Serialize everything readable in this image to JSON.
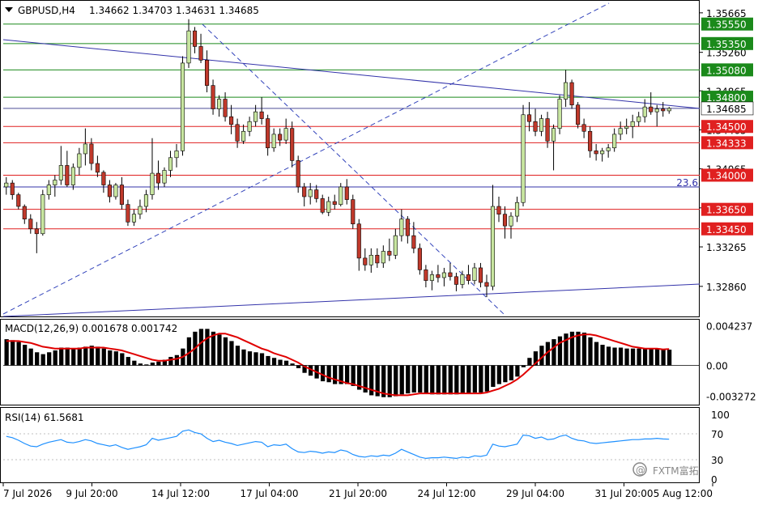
{
  "header": {
    "symbol": "GBPUSD,H4",
    "ohlc": "1.34662 1.34703 1.34631 1.34685"
  },
  "indicators": {
    "macd_label": "MACD(12,26,9) 0.001678 0.001742",
    "rsi_label": "RSI(14) 61.5681",
    "fib_label": "23.6"
  },
  "watermark": {
    "text": "FXTM富拓",
    "logo_text": "@"
  },
  "chart_data": [
    {
      "type": "candlestick",
      "name": "price",
      "title": "",
      "colors": {
        "bull": "#c8e6a0",
        "bear": "#c0392b",
        "wick": "#000000",
        "grid": "#d0d0d0",
        "frame": "#000000"
      },
      "ylim": [
        1.3256,
        1.3578
      ],
      "yticks": [
        1.35665,
        1.3526,
        1.34865,
        1.34465,
        1.34065,
        1.33665,
        1.33265,
        1.3286
      ],
      "ytick_labels": [
        "1.35665",
        "1.35260",
        "1.34865",
        "1.34465",
        "1.34065",
        "1.33665",
        "1.33265",
        "1.32860"
      ],
      "hlines": [
        {
          "value": 1.3555,
          "label": "1.35550",
          "color": "#1b8a1b"
        },
        {
          "value": 1.3535,
          "label": "1.35350",
          "color": "#1b8a1b"
        },
        {
          "value": 1.3508,
          "label": "1.35080",
          "color": "#1b8a1b"
        },
        {
          "value": 1.348,
          "label": "1.34800",
          "color": "#1b8a1b"
        },
        {
          "value": 1.345,
          "label": "1.34500",
          "color": "#e02020"
        },
        {
          "value": 1.34333,
          "label": "1.34333",
          "color": "#e02020"
        },
        {
          "value": 1.34,
          "label": "1.34000",
          "color": "#e02020"
        },
        {
          "value": 1.3365,
          "label": "1.33650",
          "color": "#e02020"
        },
        {
          "value": 1.3345,
          "label": "1.33450",
          "color": "#e02020"
        }
      ],
      "current_price": {
        "value": 1.34685,
        "label": "1.34685"
      },
      "fib_line": {
        "value": 1.3388,
        "label": "23.6"
      },
      "x_labels": [
        "7 Jul 2026",
        "9 Jul 20:00",
        "14 Jul 12:00",
        "17 Jul 04:00",
        "21 Jul 20:00",
        "24 Jul 12:00",
        "29 Jul 04:00",
        "31 Jul 20:00",
        "5 Aug 12:00"
      ],
      "candles": [
        [
          1.3388,
          1.3398,
          1.338,
          1.3392
        ],
        [
          1.3392,
          1.3395,
          1.3375,
          1.338
        ],
        [
          1.338,
          1.3382,
          1.3365,
          1.3368
        ],
        [
          1.3368,
          1.337,
          1.335,
          1.3355
        ],
        [
          1.3355,
          1.336,
          1.334,
          1.3345
        ],
        [
          1.3345,
          1.3352,
          1.332,
          1.334
        ],
        [
          1.334,
          1.3385,
          1.3338,
          1.338
        ],
        [
          1.338,
          1.3395,
          1.3375,
          1.339
        ],
        [
          1.339,
          1.34,
          1.3378,
          1.3395
        ],
        [
          1.3395,
          1.343,
          1.339,
          1.341
        ],
        [
          1.341,
          1.3425,
          1.3388,
          1.339
        ],
        [
          1.339,
          1.3412,
          1.3385,
          1.3408
        ],
        [
          1.3408,
          1.3428,
          1.34,
          1.3422
        ],
        [
          1.3422,
          1.3448,
          1.341,
          1.3432
        ],
        [
          1.3432,
          1.3438,
          1.3405,
          1.3412
        ],
        [
          1.3412,
          1.342,
          1.3398,
          1.3403
        ],
        [
          1.3403,
          1.3405,
          1.3382,
          1.339
        ],
        [
          1.339,
          1.3395,
          1.3372,
          1.3378
        ],
        [
          1.3378,
          1.3392,
          1.3375,
          1.339
        ],
        [
          1.339,
          1.3398,
          1.3365,
          1.337
        ],
        [
          1.337,
          1.3375,
          1.3348,
          1.3352
        ],
        [
          1.3352,
          1.3365,
          1.3348,
          1.336
        ],
        [
          1.336,
          1.3375,
          1.3355,
          1.3368
        ],
        [
          1.3368,
          1.3385,
          1.3362,
          1.338
        ],
        [
          1.338,
          1.3438,
          1.3375,
          1.3402
        ],
        [
          1.3402,
          1.3415,
          1.3385,
          1.3392
        ],
        [
          1.3392,
          1.3408,
          1.3388,
          1.3405
        ],
        [
          1.3405,
          1.3425,
          1.3398,
          1.3418
        ],
        [
          1.3418,
          1.3432,
          1.3408,
          1.3425
        ],
        [
          1.3425,
          1.3522,
          1.342,
          1.3515
        ],
        [
          1.3515,
          1.356,
          1.351,
          1.3548
        ],
        [
          1.3548,
          1.3552,
          1.3525,
          1.3532
        ],
        [
          1.3532,
          1.3545,
          1.3515,
          1.3518
        ],
        [
          1.3518,
          1.3528,
          1.3485,
          1.3492
        ],
        [
          1.3492,
          1.3498,
          1.3462,
          1.3468
        ],
        [
          1.3468,
          1.3482,
          1.346,
          1.3478
        ],
        [
          1.3478,
          1.3485,
          1.3455,
          1.346
        ],
        [
          1.346,
          1.3472,
          1.3442,
          1.3452
        ],
        [
          1.3452,
          1.3458,
          1.3428,
          1.3435
        ],
        [
          1.3435,
          1.3452,
          1.3432,
          1.3445
        ],
        [
          1.3445,
          1.346,
          1.344,
          1.3455
        ],
        [
          1.3455,
          1.3472,
          1.345,
          1.3465
        ],
        [
          1.3465,
          1.348,
          1.3452,
          1.3458
        ],
        [
          1.3458,
          1.3462,
          1.342,
          1.3428
        ],
        [
          1.3428,
          1.3448,
          1.3424,
          1.3442
        ],
        [
          1.3442,
          1.3448,
          1.343,
          1.3436
        ],
        [
          1.3436,
          1.3458,
          1.3432,
          1.3448
        ],
        [
          1.3448,
          1.3455,
          1.3408,
          1.3415
        ],
        [
          1.3415,
          1.342,
          1.3382,
          1.3388
        ],
        [
          1.3388,
          1.3392,
          1.3368,
          1.3378
        ],
        [
          1.3378,
          1.3392,
          1.337,
          1.3385
        ],
        [
          1.3385,
          1.339,
          1.3372,
          1.3376
        ],
        [
          1.3376,
          1.338,
          1.336,
          1.3362
        ],
        [
          1.3362,
          1.3378,
          1.3358,
          1.3373
        ],
        [
          1.3373,
          1.338,
          1.3365,
          1.337
        ],
        [
          1.337,
          1.3392,
          1.3368,
          1.3388
        ],
        [
          1.3388,
          1.3396,
          1.337,
          1.3375
        ],
        [
          1.3375,
          1.338,
          1.3345,
          1.335
        ],
        [
          1.335,
          1.3355,
          1.3302,
          1.3315
        ],
        [
          1.3315,
          1.3325,
          1.3302,
          1.3308
        ],
        [
          1.3308,
          1.3325,
          1.33,
          1.3318
        ],
        [
          1.3318,
          1.3325,
          1.3305,
          1.331
        ],
        [
          1.331,
          1.3328,
          1.3305,
          1.3322
        ],
        [
          1.3322,
          1.3335,
          1.3312,
          1.3318
        ],
        [
          1.3318,
          1.3345,
          1.3314,
          1.3338
        ],
        [
          1.3338,
          1.3365,
          1.3332,
          1.3355
        ],
        [
          1.3355,
          1.3358,
          1.333,
          1.3338
        ],
        [
          1.3338,
          1.3352,
          1.332,
          1.3325
        ],
        [
          1.3325,
          1.333,
          1.3298,
          1.3303
        ],
        [
          1.3303,
          1.3308,
          1.3285,
          1.3292
        ],
        [
          1.3292,
          1.3302,
          1.3282,
          1.3298
        ],
        [
          1.3298,
          1.3308,
          1.329,
          1.3295
        ],
        [
          1.3295,
          1.3305,
          1.3286,
          1.33
        ],
        [
          1.33,
          1.331,
          1.3292,
          1.3296
        ],
        [
          1.3296,
          1.33,
          1.3281,
          1.3288
        ],
        [
          1.3288,
          1.3302,
          1.3284,
          1.3298
        ],
        [
          1.3298,
          1.3308,
          1.3288,
          1.3292
        ],
        [
          1.3292,
          1.331,
          1.3288,
          1.3305
        ],
        [
          1.3305,
          1.331,
          1.3285,
          1.329
        ],
        [
          1.329,
          1.3298,
          1.3275,
          1.3286
        ],
        [
          1.3286,
          1.339,
          1.3282,
          1.3368
        ],
        [
          1.3368,
          1.3378,
          1.3352,
          1.336
        ],
        [
          1.336,
          1.3368,
          1.3335,
          1.3348
        ],
        [
          1.3348,
          1.3362,
          1.3335,
          1.3358
        ],
        [
          1.3358,
          1.3378,
          1.3352,
          1.3372
        ],
        [
          1.3372,
          1.3472,
          1.3368,
          1.3462
        ],
        [
          1.3462,
          1.3475,
          1.3445,
          1.3455
        ],
        [
          1.3455,
          1.3468,
          1.344,
          1.3445
        ],
        [
          1.3445,
          1.3462,
          1.344,
          1.3458
        ],
        [
          1.3458,
          1.3465,
          1.3428,
          1.3435
        ],
        [
          1.3435,
          1.3452,
          1.3405,
          1.3448
        ],
        [
          1.3448,
          1.3482,
          1.3442,
          1.3478
        ],
        [
          1.3478,
          1.3508,
          1.347,
          1.3495
        ],
        [
          1.3495,
          1.3498,
          1.3468,
          1.3472
        ],
        [
          1.3472,
          1.3475,
          1.3448,
          1.3452
        ],
        [
          1.3452,
          1.3458,
          1.3438,
          1.3445
        ],
        [
          1.3445,
          1.345,
          1.3418,
          1.3425
        ],
        [
          1.3425,
          1.3432,
          1.3415,
          1.3422
        ],
        [
          1.3422,
          1.3428,
          1.3414,
          1.3425
        ],
        [
          1.3425,
          1.3432,
          1.3418,
          1.3428
        ],
        [
          1.3428,
          1.3448,
          1.3424,
          1.3442
        ],
        [
          1.3442,
          1.3455,
          1.3436,
          1.3448
        ],
        [
          1.3448,
          1.3458,
          1.3442,
          1.345
        ],
        [
          1.345,
          1.3462,
          1.3438,
          1.3455
        ],
        [
          1.3455,
          1.3465,
          1.345,
          1.346
        ],
        [
          1.346,
          1.3478,
          1.3454,
          1.347
        ],
        [
          1.347,
          1.3485,
          1.3462,
          1.3465
        ],
        [
          1.3465,
          1.3472,
          1.345,
          1.3468
        ],
        [
          1.3468,
          1.3475,
          1.346,
          1.3466
        ],
        [
          1.3466,
          1.347,
          1.3463,
          1.34685
        ]
      ]
    },
    {
      "type": "bar",
      "name": "MACD(12,26,9)",
      "title": "",
      "ylim": [
        -0.0042,
        0.0048
      ],
      "yticks": [
        0.004237,
        0.0,
        -0.003272
      ],
      "ytick_labels": [
        "0.004237",
        "0.00",
        "-0.003272"
      ],
      "series": [
        {
          "name": "MACD",
          "type": "bar",
          "color": "#000000",
          "values": [
            0.0028,
            0.0027,
            0.0025,
            0.0022,
            0.0018,
            0.0014,
            0.0012,
            0.0014,
            0.0016,
            0.0019,
            0.0019,
            0.0018,
            0.0019,
            0.002,
            0.0021,
            0.002,
            0.0018,
            0.0016,
            0.0015,
            0.0013,
            0.0009,
            0.0005,
            0.0002,
            0.0001,
            0.0003,
            0.0004,
            0.0006,
            0.0009,
            0.0011,
            0.0018,
            0.003,
            0.0036,
            0.0039,
            0.0039,
            0.0036,
            0.0033,
            0.003,
            0.0026,
            0.0021,
            0.0017,
            0.0015,
            0.0014,
            0.0013,
            0.001,
            0.0008,
            0.0006,
            0.0005,
            0.0002,
            -0.0003,
            -0.0008,
            -0.0011,
            -0.0014,
            -0.0017,
            -0.0018,
            -0.002,
            -0.002,
            -0.002,
            -0.0022,
            -0.0026,
            -0.0029,
            -0.0032,
            -0.0033,
            -0.0034,
            -0.0034,
            -0.0033,
            -0.0031,
            -0.003,
            -0.0029,
            -0.0029,
            -0.003,
            -0.0031,
            -0.0031,
            -0.0031,
            -0.0031,
            -0.0031,
            -0.003,
            -0.003,
            -0.0029,
            -0.0029,
            -0.0028,
            -0.0023,
            -0.002,
            -0.0018,
            -0.0016,
            -0.0012,
            -0.0002,
            0.0008,
            0.0015,
            0.0021,
            0.0025,
            0.0028,
            0.0031,
            0.0034,
            0.0036,
            0.0036,
            0.0035,
            0.003,
            0.0025,
            0.0022,
            0.002,
            0.0019,
            0.0019,
            0.0018,
            0.0018,
            0.0018,
            0.0018,
            0.0018,
            0.0018,
            0.00172,
            0.001678
          ]
        },
        {
          "name": "Signal",
          "type": "line",
          "color": "#e00000",
          "values": [
            0.0026,
            0.0026,
            0.0026,
            0.0025,
            0.0024,
            0.0022,
            0.002,
            0.0019,
            0.0018,
            0.0018,
            0.0018,
            0.0018,
            0.0018,
            0.0019,
            0.0019,
            0.0019,
            0.0019,
            0.0018,
            0.0017,
            0.0016,
            0.0014,
            0.0012,
            0.001,
            0.0008,
            0.0006,
            0.0005,
            0.0005,
            0.0006,
            0.0007,
            0.0009,
            0.0013,
            0.0018,
            0.0024,
            0.0029,
            0.0032,
            0.0034,
            0.0034,
            0.0032,
            0.003,
            0.0027,
            0.0024,
            0.0021,
            0.0018,
            0.0016,
            0.0013,
            0.0011,
            0.0009,
            0.0006,
            0.0003,
            -0.0001,
            -0.0004,
            -0.0007,
            -0.001,
            -0.0013,
            -0.0015,
            -0.0017,
            -0.0019,
            -0.002,
            -0.0022,
            -0.0024,
            -0.0026,
            -0.0028,
            -0.003,
            -0.0031,
            -0.0032,
            -0.0032,
            -0.0032,
            -0.0031,
            -0.003,
            -0.003,
            -0.003,
            -0.003,
            -0.003,
            -0.003,
            -0.003,
            -0.003,
            -0.003,
            -0.003,
            -0.003,
            -0.0029,
            -0.0027,
            -0.0025,
            -0.0022,
            -0.0019,
            -0.0015,
            -0.001,
            -0.0004,
            0.0002,
            0.0008,
            0.0014,
            0.0019,
            0.0024,
            0.0027,
            0.003,
            0.0032,
            0.0033,
            0.0033,
            0.0032,
            0.003,
            0.0028,
            0.0026,
            0.0024,
            0.0022,
            0.002,
            0.0019,
            0.0018,
            0.0018,
            0.0018,
            0.0017,
            0.001742
          ]
        }
      ]
    },
    {
      "type": "line",
      "name": "RSI(14)",
      "title": "",
      "ylim": [
        0,
        100
      ],
      "yticks": [
        100,
        70,
        30,
        0
      ],
      "ytick_labels": [
        "100",
        "70",
        "30",
        "0"
      ],
      "levels": [
        70,
        30
      ],
      "series": [
        {
          "name": "RSI",
          "color": "#1e90ff",
          "values": [
            66,
            64,
            60,
            55,
            51,
            50,
            54,
            57,
            59,
            61,
            57,
            56,
            58,
            61,
            59,
            55,
            53,
            51,
            53,
            49,
            46,
            48,
            50,
            53,
            63,
            60,
            62,
            64,
            66,
            74,
            76,
            72,
            70,
            63,
            58,
            60,
            57,
            55,
            52,
            54,
            56,
            58,
            57,
            50,
            53,
            52,
            54,
            47,
            42,
            41,
            43,
            42,
            40,
            42,
            41,
            45,
            43,
            38,
            35,
            34,
            36,
            35,
            37,
            36,
            40,
            46,
            42,
            38,
            34,
            32,
            33,
            33,
            34,
            33,
            32,
            34,
            33,
            36,
            35,
            37,
            54,
            51,
            50,
            52,
            54,
            68,
            67,
            63,
            65,
            61,
            62,
            66,
            68,
            63,
            60,
            59,
            56,
            55,
            56,
            57,
            58,
            59,
            60,
            61,
            61,
            62,
            62,
            63,
            62,
            61.5681
          ]
        }
      ]
    }
  ]
}
